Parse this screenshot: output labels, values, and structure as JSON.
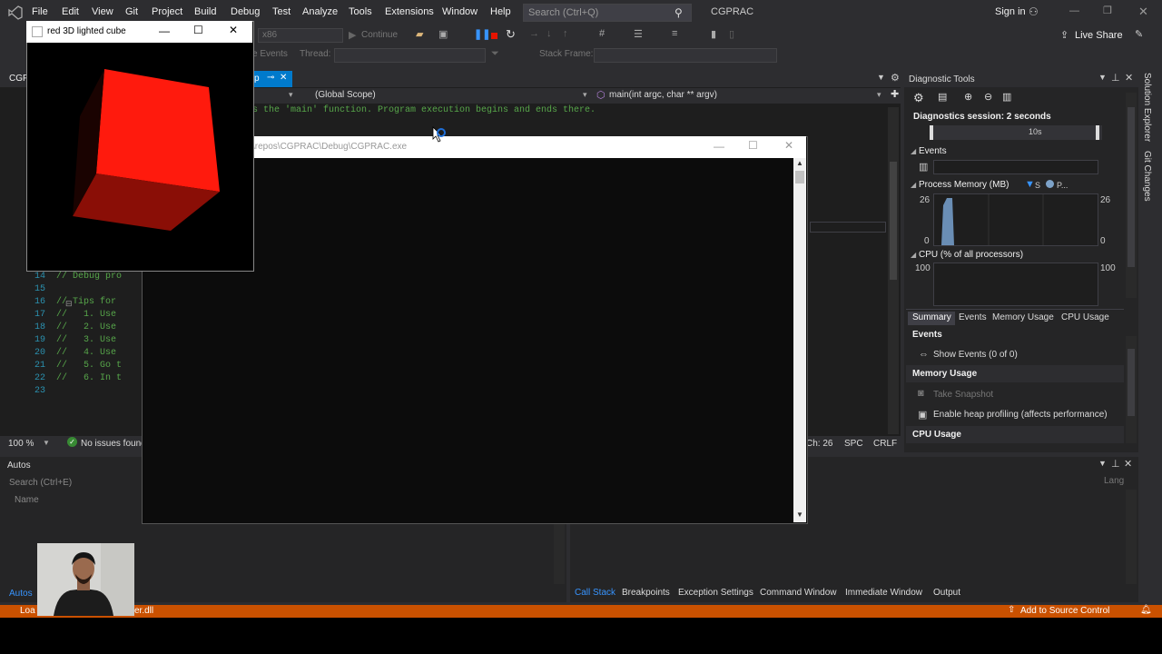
{
  "menubar": {
    "items": [
      "File",
      "Edit",
      "View",
      "Git",
      "Project",
      "Build",
      "Debug",
      "Test",
      "Analyze",
      "Tools",
      "Extensions",
      "Window",
      "Help"
    ],
    "search_placeholder": "Search (Ctrl+Q)",
    "solution_name": "CGPRAC",
    "sign_in": "Sign in",
    "live_share": "Live Share"
  },
  "toolbar": {
    "platform": "x86",
    "continue_label": "Continue",
    "events_label": "e Events",
    "thread_label": "Thread:",
    "stack_frame_label": "Stack Frame:"
  },
  "editor": {
    "file_tab": "CGP",
    "tab_fragment": "p",
    "scope_label": "(Global Scope)",
    "function_label": "main(int argc, char ** argv)",
    "top_comment": "s the 'main' function. Program execution begins and ends there.",
    "lines": [
      {
        "num": "14",
        "text": "// Debug pro"
      },
      {
        "num": "15",
        "text": ""
      },
      {
        "num": "16",
        "text": "// Tips for"
      },
      {
        "num": "17",
        "text": "//   1. Use"
      },
      {
        "num": "18",
        "text": "//   2. Use"
      },
      {
        "num": "19",
        "text": "//   3. Use"
      },
      {
        "num": "20",
        "text": "//   4. Use"
      },
      {
        "num": "21",
        "text": "//   5. Go t"
      },
      {
        "num": "22",
        "text": "//   6. In t"
      },
      {
        "num": "23",
        "text": ""
      }
    ],
    "zoom": "100 %",
    "issues": "No issues found",
    "ch": "Ch: 26",
    "spc": "SPC",
    "crlf": "CRLF"
  },
  "diagnostics": {
    "title": "Diagnostic Tools",
    "session": "Diagnostics session: 2 seconds",
    "timeline_label": "10s",
    "events_header": "Events",
    "memory_header": "Process Memory (MB)",
    "memory_legend_s": "S",
    "memory_legend_p": "P...",
    "memory_max": "26",
    "memory_min": "0",
    "cpu_header": "CPU (% of all processors)",
    "cpu_max": "100",
    "tabs": [
      "Summary",
      "Events",
      "Memory Usage",
      "CPU Usage"
    ],
    "summary_events": "Events",
    "show_events": "Show Events (0 of 0)",
    "memory_usage": "Memory Usage",
    "take_snapshot": "Take Snapshot",
    "heap_profiling": "Enable heap profiling (affects performance)",
    "cpu_usage": "CPU Usage"
  },
  "autos": {
    "title": "Autos",
    "search_placeholder": "Search (Ctrl+E)",
    "column_name": "Name",
    "bottom_tab": "Autos",
    "lang_label": "Lang"
  },
  "bottom_tabs": [
    "Call Stack",
    "Breakpoints",
    "Exception Settings",
    "Command Window",
    "Immediate Window",
    "Output"
  ],
  "right_rail": [
    "Solution Explorer",
    "Git Changes"
  ],
  "console": {
    "title": "\\repos\\CGPRAC\\Debug\\CGPRAC.exe"
  },
  "cube_window": {
    "title": "red 3D lighted cube",
    "cube_color": "#e8160c"
  },
  "statusbar": {
    "left_text": "Loa",
    "dll_text": "er.dll",
    "add_source": "Add to Source Control"
  },
  "colors": {
    "accent_orange": "#ca5100",
    "vs_background": "#2d2d30",
    "editor_background": "#1e1e1e",
    "link_blue": "#3794ff"
  }
}
